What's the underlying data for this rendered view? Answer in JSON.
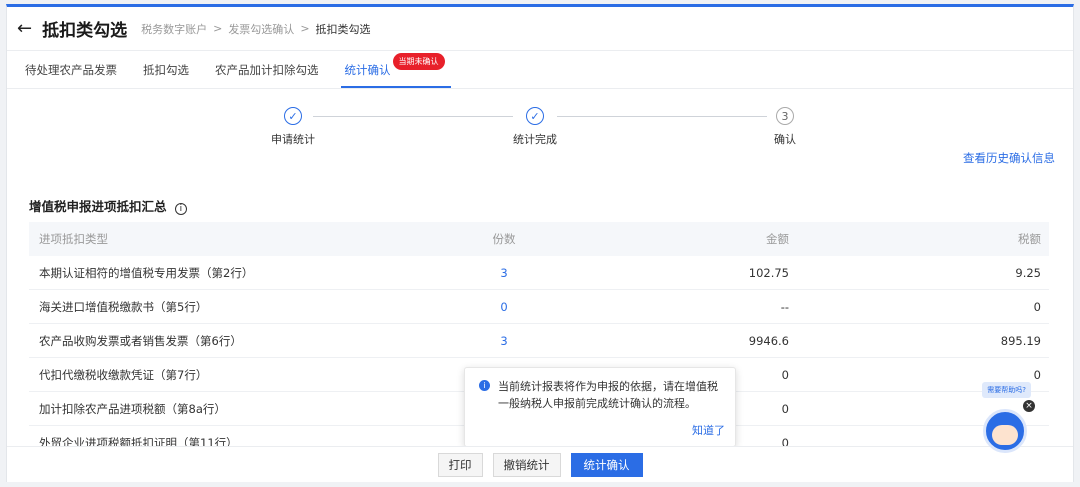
{
  "header": {
    "back_icon": "←",
    "title": "抵扣类勾选",
    "breadcrumb": [
      "税务数字账户",
      "发票勾选确认",
      "抵扣类勾选"
    ],
    "separator": ">"
  },
  "tabs": [
    {
      "label": "待处理农产品发票"
    },
    {
      "label": "抵扣勾选"
    },
    {
      "label": "农产品加计扣除勾选"
    },
    {
      "label": "统计确认",
      "badge": "当期未确认",
      "active": true
    }
  ],
  "steps": [
    {
      "label": "申请统计",
      "mark": "✓"
    },
    {
      "label": "统计完成",
      "mark": "✓"
    },
    {
      "label": "确认",
      "mark": "3"
    }
  ],
  "history_link": "查看历史确认信息",
  "section": {
    "title": "增值税申报进项抵扣汇总",
    "info_icon": "i"
  },
  "table": {
    "columns": [
      "进项抵扣类型",
      "份数",
      "金额",
      "税额"
    ],
    "rows": [
      {
        "type": "本期认证相符的增值税专用发票（第2行）",
        "count": "3",
        "amount": "102.75",
        "tax": "9.25"
      },
      {
        "type": "海关进口增值税缴款书（第5行）",
        "count": "0",
        "amount": "--",
        "tax": "0"
      },
      {
        "type": "农产品收购发票或者销售发票（第6行）",
        "count": "3",
        "amount": "9946.6",
        "tax": "895.19"
      },
      {
        "type": "代扣代缴税收缴款凭证（第7行）",
        "count": "",
        "amount": "0",
        "tax": "0"
      },
      {
        "type": "加计扣除农产品进项税额（第8a行）",
        "count": "",
        "amount": "0",
        "tax": ""
      },
      {
        "type": "外贸企业进项税额抵扣证明（第11行）",
        "count": "",
        "amount": "0",
        "tax": ""
      }
    ]
  },
  "tooltip": {
    "text": "当前统计报表将作为申报的依据，请在增值税一般纳税人申报前完成统计确认的流程。",
    "ok": "知道了"
  },
  "footer": {
    "print": "打印",
    "cancel": "撤销统计",
    "confirm": "统计确认"
  },
  "helper": {
    "bubble": "需要帮助吗?",
    "close": "×"
  },
  "colors": {
    "accent": "#2b6de5",
    "badge": "#e8202a"
  }
}
